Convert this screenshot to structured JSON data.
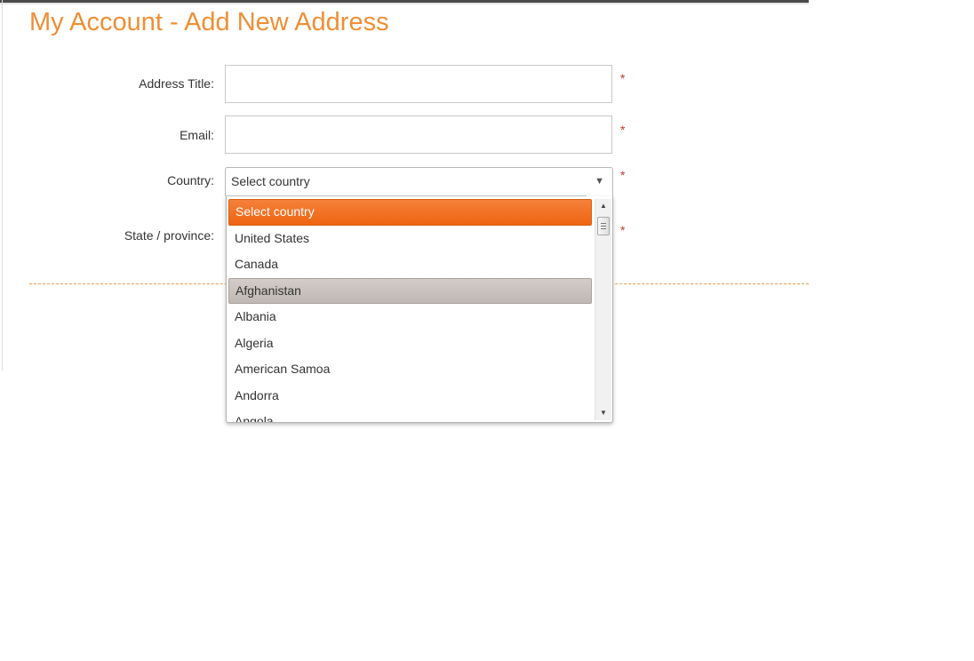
{
  "page": {
    "title": "My Account - Add New Address"
  },
  "form": {
    "address_title": {
      "label": "Address Title:",
      "value": "",
      "placeholder": "",
      "required_mark": "*"
    },
    "email": {
      "label": "Email:",
      "value": "",
      "placeholder": "",
      "required_mark": "*"
    },
    "country": {
      "label": "Country:",
      "selected": "Select country",
      "required_mark": "*",
      "arrow_icon": "triangle-down-icon"
    },
    "state": {
      "label": "State / province:",
      "required_mark": "*"
    }
  },
  "dropdown": {
    "options": [
      "Select country",
      "United States",
      "Canada",
      "Afghanistan",
      "Albania",
      "Algeria",
      "American Samoa",
      "Andorra",
      "Angola"
    ],
    "selected_index": 0,
    "hover_index": 3,
    "scroll_position": 0.0
  },
  "colors": {
    "title": "#ef8f35",
    "selected_option": "#ee6412",
    "hover_option": "#c6bfba",
    "required": "#c0392b",
    "divider": "#ef9a4a"
  }
}
